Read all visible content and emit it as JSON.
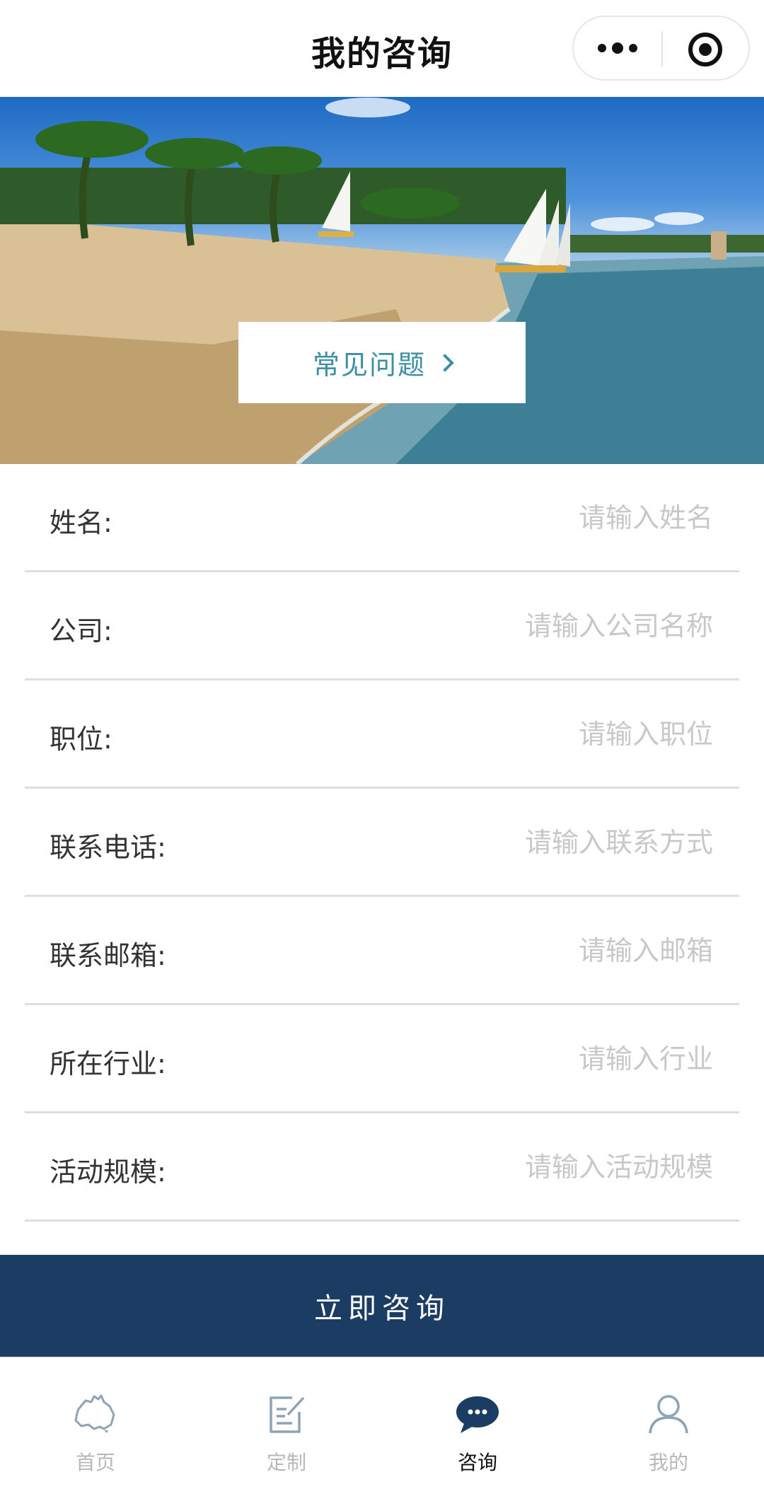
{
  "nav": {
    "title": "我的咨询",
    "more_icon": "more-dots-icon",
    "close_icon": "target-circle-icon"
  },
  "banner": {
    "faq_label": "常见问题",
    "faq_icon": "chevron-right-icon"
  },
  "form": {
    "fields": [
      {
        "label": "姓名:",
        "placeholder": "请输入姓名"
      },
      {
        "label": "公司:",
        "placeholder": "请输入公司名称"
      },
      {
        "label": "职位:",
        "placeholder": "请输入职位"
      },
      {
        "label": "联系电话:",
        "placeholder": "请输入联系方式"
      },
      {
        "label": "联系邮箱:",
        "placeholder": "请输入邮箱"
      },
      {
        "label": "所在行业:",
        "placeholder": "请输入行业"
      },
      {
        "label": "活动规模:",
        "placeholder": "请输入活动规模"
      }
    ],
    "submit_label": "立即咨询"
  },
  "tabbar": {
    "items": [
      {
        "label": "首页",
        "icon": "australia-map-icon",
        "active": false
      },
      {
        "label": "定制",
        "icon": "edit-note-icon",
        "active": false
      },
      {
        "label": "咨询",
        "icon": "chat-bubble-icon",
        "active": true
      },
      {
        "label": "我的",
        "icon": "user-profile-icon",
        "active": false
      }
    ]
  },
  "colors": {
    "primary": "#1b3d63",
    "faq_text": "#3d8fa6",
    "placeholder": "#c8c8c8",
    "tab_inactive": "#b8b8b8",
    "tab_icon_inactive": "#8fa3b6"
  }
}
